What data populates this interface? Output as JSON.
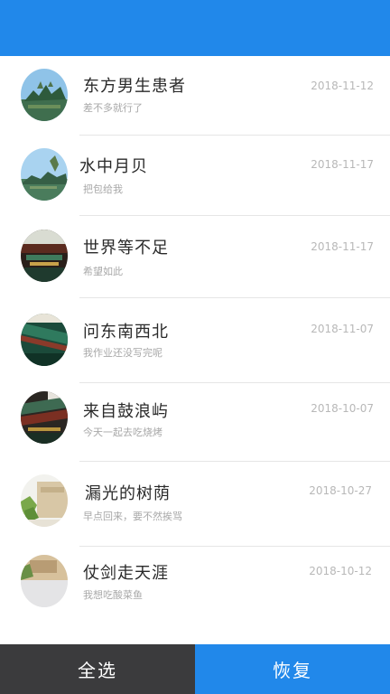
{
  "colors": {
    "accent": "#2188ea",
    "bottom_left_bg": "#3b3b3d",
    "name_text": "#2a2a2a",
    "meta_text": "#a8a8a8"
  },
  "items": [
    {
      "name": "东方男生患者",
      "message": "差不多就行了",
      "date": "2018-11-12"
    },
    {
      "name": "水中月贝",
      "message": "把包给我",
      "date": "2018-11-17"
    },
    {
      "name": "世界等不足",
      "message": "希望如此",
      "date": "2018-11-17"
    },
    {
      "name": "问东南西北",
      "message": "我作业还没写完呢",
      "date": "2018-11-07"
    },
    {
      "name": "来自鼓浪屿",
      "message": "今天一起去吃烧烤",
      "date": "2018-10-07"
    },
    {
      "name": "漏光的树荫",
      "message": "早点回来，要不然挨骂",
      "date": "2018-10-27"
    },
    {
      "name": "仗剑走天涯",
      "message": "我想吃酸菜鱼",
      "date": "2018-10-12"
    }
  ],
  "bottom": {
    "select_all_label": "全选",
    "restore_label": "恢复"
  }
}
